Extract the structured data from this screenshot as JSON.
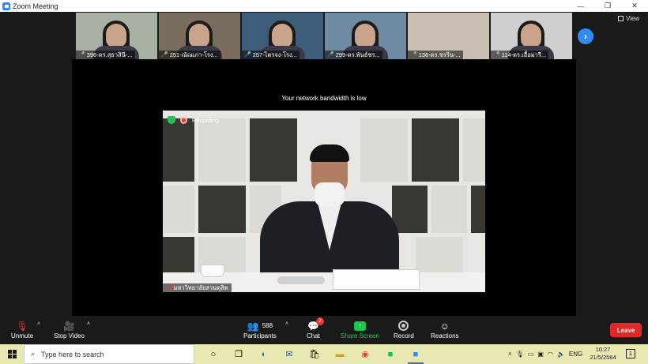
{
  "window": {
    "title": "Zoom Meeting",
    "controls": [
      "—",
      "❐",
      "✕"
    ]
  },
  "gallery": {
    "thumbnails": [
      {
        "name": "396-ดร.สุธาสินี-...",
        "bg": "#a9b0a4",
        "muted": true
      },
      {
        "name": "251-ณัณเภา-โรง...",
        "bg": "#7a6d5e",
        "muted": true
      },
      {
        "name": "257-ไตรจง-โรง...",
        "bg": "#3e5d7a",
        "muted": true
      },
      {
        "name": "299-ดร.พันธ์ชร...",
        "bg": "#6f8aa3",
        "muted": true
      },
      {
        "name": "136-ดร.ชรริน-...",
        "bg": "#c9c0b3",
        "muted": true
      },
      {
        "name": "114-ดร.เอื้อมารี...",
        "bg": "#cfcfcf",
        "muted": true
      }
    ],
    "next_icon": "chevron-right-icon",
    "view_label": "View"
  },
  "stage": {
    "bandwidth_notice": "Your network bandwidth is low",
    "recording_label": "Recording",
    "speaker_name": "มหาวิทยาลัยสวนดุสิต"
  },
  "controls": {
    "unmute": "Unmute",
    "stop_video": "Stop Video",
    "participants": "Participants",
    "participant_count": "588",
    "chat": "Chat",
    "chat_badge": "2",
    "share_screen": "Share Screen",
    "record": "Record",
    "reactions": "Reactions",
    "leave": "Leave"
  },
  "taskbar": {
    "search_placeholder": "Type here to search",
    "language": "ENG",
    "time": "10:27",
    "date": "21/5/2564",
    "notification_count": "1"
  },
  "colors": {
    "zoom_blue": "#2d8cff",
    "share_green": "#23c552",
    "leave_red": "#e02828",
    "taskbar": "#e8e9b0"
  }
}
